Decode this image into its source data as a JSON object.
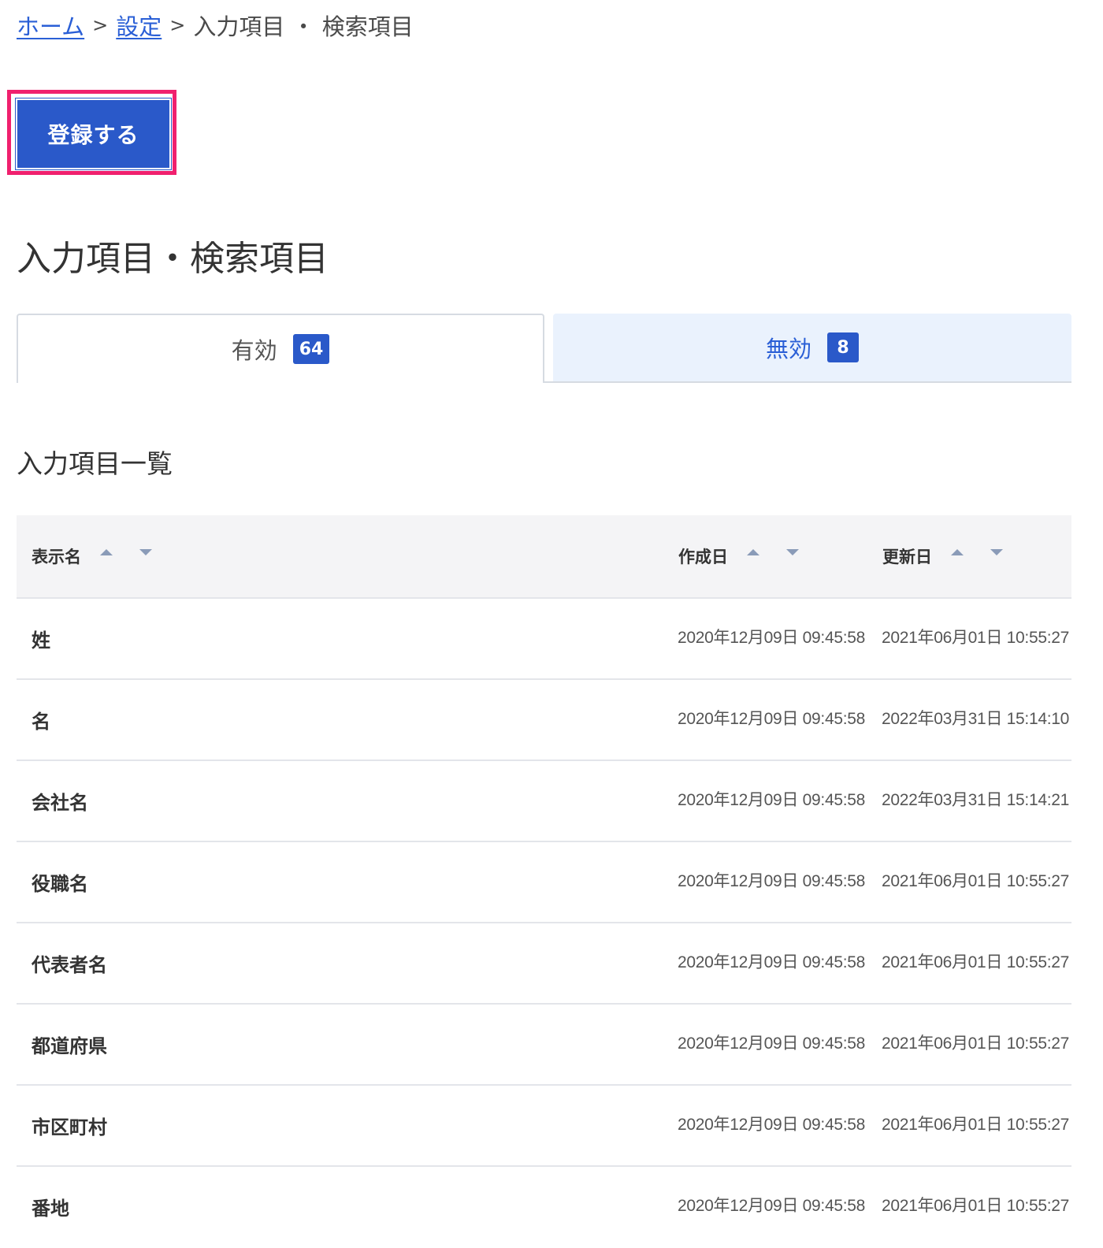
{
  "breadcrumb": {
    "home": "ホーム",
    "sep1": ">",
    "settings": "設定",
    "sep2": ">",
    "current": "入力項目 ・ 検索項目"
  },
  "actions": {
    "register_label": "登録する"
  },
  "page": {
    "title": "入力項目・検索項目",
    "section_title": "入力項目一覧"
  },
  "tabs": [
    {
      "label": "有効",
      "count": "64",
      "active": true
    },
    {
      "label": "無効",
      "count": "8",
      "active": false
    }
  ],
  "table": {
    "columns": {
      "name": "表示名",
      "created": "作成日",
      "updated": "更新日"
    },
    "rows": [
      {
        "name": "姓",
        "created": "2020年12月09日 09:45:58",
        "updated": "2021年06月01日 10:55:27"
      },
      {
        "name": "名",
        "created": "2020年12月09日 09:45:58",
        "updated": "2022年03月31日 15:14:10"
      },
      {
        "name": "会社名",
        "created": "2020年12月09日 09:45:58",
        "updated": "2022年03月31日 15:14:21"
      },
      {
        "name": "役職名",
        "created": "2020年12月09日 09:45:58",
        "updated": "2021年06月01日 10:55:27"
      },
      {
        "name": "代表者名",
        "created": "2020年12月09日 09:45:58",
        "updated": "2021年06月01日 10:55:27"
      },
      {
        "name": "都道府県",
        "created": "2020年12月09日 09:45:58",
        "updated": "2021年06月01日 10:55:27"
      },
      {
        "name": "市区町村",
        "created": "2020年12月09日 09:45:58",
        "updated": "2021年06月01日 10:55:27"
      },
      {
        "name": "番地",
        "created": "2020年12月09日 09:45:58",
        "updated": "2021年06月01日 10:55:27"
      }
    ]
  },
  "colors": {
    "primary": "#2a59c9",
    "link": "#2a5fd6",
    "highlight": "#f0206e",
    "tab_inactive_bg": "#eaf2fd",
    "header_bg": "#f4f4f6"
  }
}
